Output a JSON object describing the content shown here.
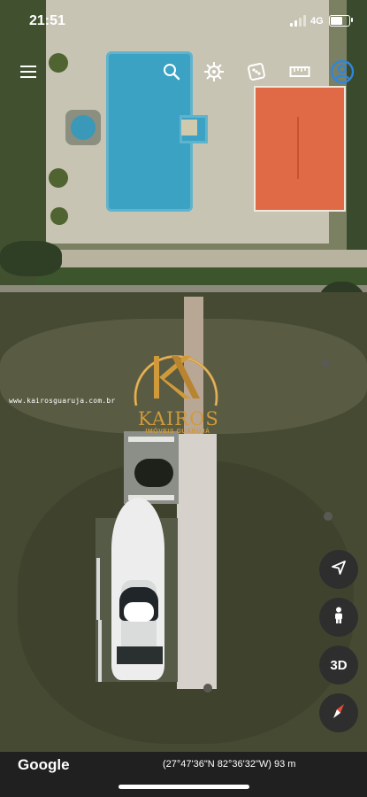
{
  "status_bar": {
    "time": "21:51",
    "network": "4G"
  },
  "toolbar": {
    "icons": [
      "menu-icon",
      "search-icon",
      "voyager-icon",
      "dice-icon",
      "ruler-icon",
      "account-icon"
    ],
    "accent_color": "#2e86de"
  },
  "watermark": {
    "url": "www.kairosguaruja.com.br",
    "logo_text": "KAIROS",
    "logo_subtext": "IMÓVEIS GUARUJÁ",
    "color": "#d09a3a"
  },
  "controls": {
    "location_icon": "navigation-arrow-icon",
    "street_view_icon": "pegman-icon",
    "view_mode_label": "3D",
    "compass_icon": "compass-icon"
  },
  "bottom_bar": {
    "brand": "Google",
    "coordinates": "(27°47'36\"N 82°36'32\"W) 93 m"
  }
}
